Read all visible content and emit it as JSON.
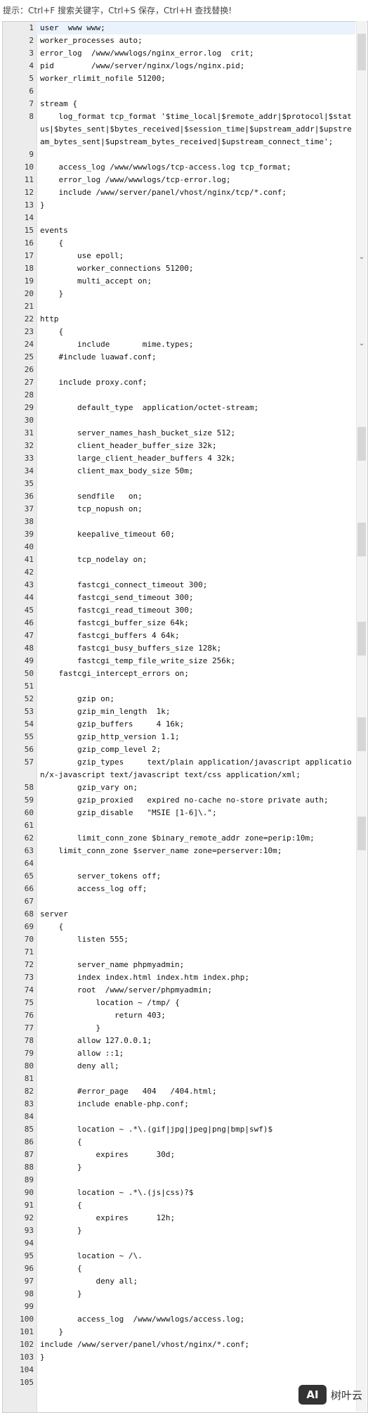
{
  "hint": "提示：Ctrl+F 搜索关键字，Ctrl+S 保存，Ctrl+H 查找替换!",
  "brand": {
    "logo_text": "AI",
    "name": "树叶云"
  },
  "lines": [
    {
      "n": "1",
      "t": "user  www www;"
    },
    {
      "n": "2",
      "t": "worker_processes auto;"
    },
    {
      "n": "3",
      "t": "error_log  /www/wwwlogs/nginx_error.log  crit;"
    },
    {
      "n": "4",
      "t": "pid        /www/server/nginx/logs/nginx.pid;"
    },
    {
      "n": "5",
      "t": "worker_rlimit_nofile 51200;"
    },
    {
      "n": "6",
      "t": ""
    },
    {
      "n": "7",
      "t": "stream {"
    },
    {
      "n": "8",
      "t": "    log_format tcp_format '$time_local|$remote_addr|$protocol|$status|$bytes_sent|$bytes_received|$session_time|$upstream_addr|$upstream_bytes_sent|$upstream_bytes_received|$upstream_connect_time';"
    },
    {
      "n": "9",
      "t": ""
    },
    {
      "n": "10",
      "t": "    access_log /www/wwwlogs/tcp-access.log tcp_format;"
    },
    {
      "n": "11",
      "t": "    error_log /www/wwwlogs/tcp-error.log;"
    },
    {
      "n": "12",
      "t": "    include /www/server/panel/vhost/nginx/tcp/*.conf;"
    },
    {
      "n": "13",
      "t": "}"
    },
    {
      "n": "14",
      "t": ""
    },
    {
      "n": "15",
      "t": "events"
    },
    {
      "n": "16",
      "t": "    {"
    },
    {
      "n": "17",
      "t": "        use epoll;"
    },
    {
      "n": "18",
      "t": "        worker_connections 51200;"
    },
    {
      "n": "19",
      "t": "        multi_accept on;"
    },
    {
      "n": "20",
      "t": "    }"
    },
    {
      "n": "21",
      "t": ""
    },
    {
      "n": "22",
      "t": "http"
    },
    {
      "n": "23",
      "t": "    {"
    },
    {
      "n": "24",
      "t": "        include       mime.types;"
    },
    {
      "n": "25",
      "t": "    #include luawaf.conf;"
    },
    {
      "n": "26",
      "t": ""
    },
    {
      "n": "27",
      "t": "    include proxy.conf;"
    },
    {
      "n": "28",
      "t": ""
    },
    {
      "n": "29",
      "t": "        default_type  application/octet-stream;"
    },
    {
      "n": "30",
      "t": ""
    },
    {
      "n": "31",
      "t": "        server_names_hash_bucket_size 512;"
    },
    {
      "n": "32",
      "t": "        client_header_buffer_size 32k;"
    },
    {
      "n": "33",
      "t": "        large_client_header_buffers 4 32k;"
    },
    {
      "n": "34",
      "t": "        client_max_body_size 50m;"
    },
    {
      "n": "35",
      "t": ""
    },
    {
      "n": "36",
      "t": "        sendfile   on;"
    },
    {
      "n": "37",
      "t": "        tcp_nopush on;"
    },
    {
      "n": "38",
      "t": ""
    },
    {
      "n": "39",
      "t": "        keepalive_timeout 60;"
    },
    {
      "n": "40",
      "t": ""
    },
    {
      "n": "41",
      "t": "        tcp_nodelay on;"
    },
    {
      "n": "42",
      "t": ""
    },
    {
      "n": "43",
      "t": "        fastcgi_connect_timeout 300;"
    },
    {
      "n": "44",
      "t": "        fastcgi_send_timeout 300;"
    },
    {
      "n": "45",
      "t": "        fastcgi_read_timeout 300;"
    },
    {
      "n": "46",
      "t": "        fastcgi_buffer_size 64k;"
    },
    {
      "n": "47",
      "t": "        fastcgi_buffers 4 64k;"
    },
    {
      "n": "48",
      "t": "        fastcgi_busy_buffers_size 128k;"
    },
    {
      "n": "49",
      "t": "        fastcgi_temp_file_write_size 256k;"
    },
    {
      "n": "50",
      "t": "    fastcgi_intercept_errors on;"
    },
    {
      "n": "51",
      "t": ""
    },
    {
      "n": "52",
      "t": "        gzip on;"
    },
    {
      "n": "53",
      "t": "        gzip_min_length  1k;"
    },
    {
      "n": "54",
      "t": "        gzip_buffers     4 16k;"
    },
    {
      "n": "55",
      "t": "        gzip_http_version 1.1;"
    },
    {
      "n": "56",
      "t": "        gzip_comp_level 2;"
    },
    {
      "n": "57",
      "t": "        gzip_types     text/plain application/javascript application/x-javascript text/javascript text/css application/xml;"
    },
    {
      "n": "58",
      "t": "        gzip_vary on;"
    },
    {
      "n": "59",
      "t": "        gzip_proxied   expired no-cache no-store private auth;"
    },
    {
      "n": "60",
      "t": "        gzip_disable   \"MSIE [1-6]\\.\";"
    },
    {
      "n": "61",
      "t": ""
    },
    {
      "n": "62",
      "t": "        limit_conn_zone $binary_remote_addr zone=perip:10m;"
    },
    {
      "n": "63",
      "t": "    limit_conn_zone $server_name zone=perserver:10m;"
    },
    {
      "n": "64",
      "t": ""
    },
    {
      "n": "65",
      "t": "        server_tokens off;"
    },
    {
      "n": "66",
      "t": "        access_log off;"
    },
    {
      "n": "67",
      "t": ""
    },
    {
      "n": "68",
      "t": "server"
    },
    {
      "n": "69",
      "t": "    {"
    },
    {
      "n": "70",
      "t": "        listen 555;"
    },
    {
      "n": "71",
      "t": ""
    },
    {
      "n": "72",
      "t": "        server_name phpmyadmin;"
    },
    {
      "n": "73",
      "t": "        index index.html index.htm index.php;"
    },
    {
      "n": "74",
      "t": "        root  /www/server/phpmyadmin;"
    },
    {
      "n": "75",
      "t": "            location ~ /tmp/ {"
    },
    {
      "n": "76",
      "t": "                return 403;"
    },
    {
      "n": "77",
      "t": "            }"
    },
    {
      "n": "78",
      "t": "        allow 127.0.0.1;"
    },
    {
      "n": "79",
      "t": "        allow ::1;"
    },
    {
      "n": "80",
      "t": "        deny all;"
    },
    {
      "n": "81",
      "t": ""
    },
    {
      "n": "82",
      "t": "        #error_page   404   /404.html;"
    },
    {
      "n": "83",
      "t": "        include enable-php.conf;"
    },
    {
      "n": "84",
      "t": ""
    },
    {
      "n": "85",
      "t": "        location ~ .*\\.(gif|jpg|jpeg|png|bmp|swf)$"
    },
    {
      "n": "86",
      "t": "        {"
    },
    {
      "n": "87",
      "t": "            expires      30d;"
    },
    {
      "n": "88",
      "t": "        }"
    },
    {
      "n": "89",
      "t": ""
    },
    {
      "n": "90",
      "t": "        location ~ .*\\.(js|css)?$"
    },
    {
      "n": "91",
      "t": "        {"
    },
    {
      "n": "92",
      "t": "            expires      12h;"
    },
    {
      "n": "93",
      "t": "        }"
    },
    {
      "n": "94",
      "t": ""
    },
    {
      "n": "95",
      "t": "        location ~ /\\."
    },
    {
      "n": "96",
      "t": "        {"
    },
    {
      "n": "97",
      "t": "            deny all;"
    },
    {
      "n": "98",
      "t": "        }"
    },
    {
      "n": "99",
      "t": ""
    },
    {
      "n": "100",
      "t": "        access_log  /www/wwwlogs/access.log;"
    },
    {
      "n": "101",
      "t": "    }"
    },
    {
      "n": "102",
      "t": "include /www/server/panel/vhost/nginx/*.conf;"
    },
    {
      "n": "103",
      "t": "}"
    },
    {
      "n": "104",
      "t": ""
    },
    {
      "n": "105",
      "t": ""
    }
  ]
}
